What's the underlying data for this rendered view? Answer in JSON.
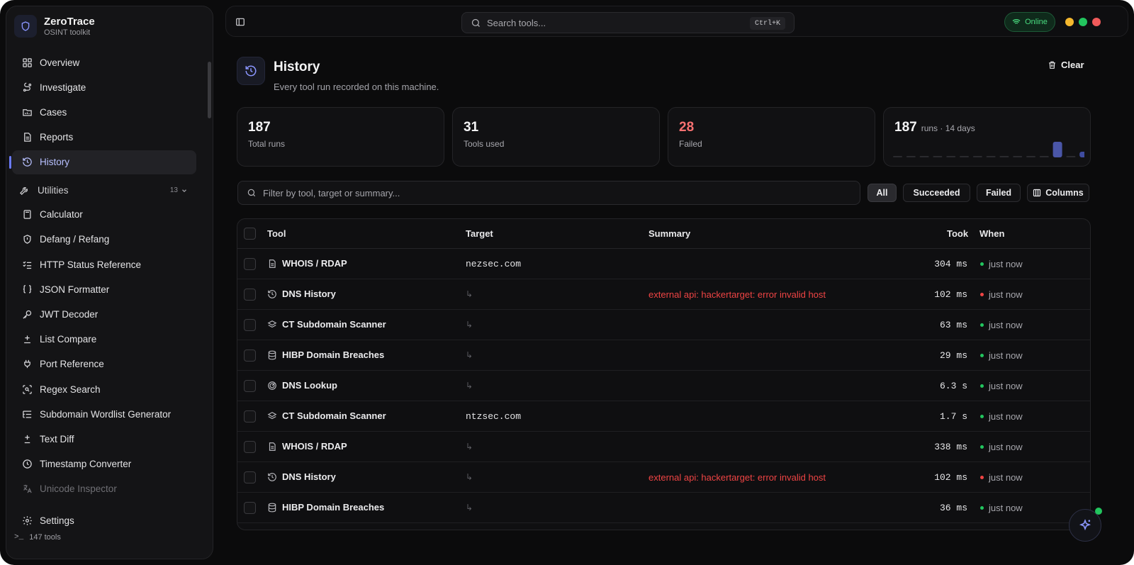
{
  "app": {
    "name": "ZeroTrace",
    "subtitle": "OSINT toolkit"
  },
  "sidebar": {
    "main_items": [
      {
        "label": "Overview",
        "icon": "grid-icon"
      },
      {
        "label": "Investigate",
        "icon": "route-icon"
      },
      {
        "label": "Cases",
        "icon": "folder-icon"
      },
      {
        "label": "Reports",
        "icon": "document-icon"
      },
      {
        "label": "History",
        "icon": "history-icon",
        "active": true
      }
    ],
    "utilities": {
      "label": "Utilities",
      "count": "13"
    },
    "utility_items": [
      {
        "label": "Calculator",
        "icon": "calculator-icon"
      },
      {
        "label": "Defang / Refang",
        "icon": "shield-icon"
      },
      {
        "label": "HTTP Status Reference",
        "icon": "list-check-icon"
      },
      {
        "label": "JSON Formatter",
        "icon": "braces-icon"
      },
      {
        "label": "JWT Decoder",
        "icon": "key-icon"
      },
      {
        "label": "List Compare",
        "icon": "compare-icon"
      },
      {
        "label": "Port Reference",
        "icon": "plug-icon"
      },
      {
        "label": "Regex Search",
        "icon": "regex-icon"
      },
      {
        "label": "Subdomain Wordlist Generator",
        "icon": "list-tree-icon"
      },
      {
        "label": "Text Diff",
        "icon": "diff-icon"
      },
      {
        "label": "Timestamp Converter",
        "icon": "clock-icon"
      },
      {
        "label": "Unicode Inspector",
        "icon": "translate-icon"
      }
    ],
    "settings_label": "Settings",
    "tools_count": "147 tools"
  },
  "topbar": {
    "search_placeholder": "Search tools...",
    "shortcut": "Ctrl+K",
    "status": "Online"
  },
  "page": {
    "title": "History",
    "subtitle": "Every tool run recorded on this machine.",
    "clear_label": "Clear"
  },
  "stats": [
    {
      "value": "187",
      "label": "Total runs"
    },
    {
      "value": "31",
      "label": "Tools used"
    },
    {
      "value": "28",
      "label": "Failed"
    },
    {
      "value": "187",
      "label": "runs · 14 days"
    }
  ],
  "sparkline": [
    0,
    0,
    0,
    0,
    0,
    0,
    0,
    0,
    0,
    0,
    0,
    0,
    22,
    0,
    8
  ],
  "filter": {
    "placeholder": "Filter by tool, target or summary...",
    "chips": [
      "All",
      "Succeeded",
      "Failed"
    ],
    "columns_label": "Columns"
  },
  "table": {
    "headers": [
      "Tool",
      "Target",
      "Summary",
      "Took",
      "When"
    ],
    "rows": [
      {
        "tool": "WHOIS / RDAP",
        "icon": "file-text-icon",
        "target": "nezsec.com",
        "summary": "",
        "took": "304 ms",
        "when": "just now",
        "ok": true
      },
      {
        "tool": "DNS History",
        "icon": "history-icon",
        "target": "↳",
        "summary": "external api: hackertarget: error invalid host",
        "took": "102 ms",
        "when": "just now",
        "ok": false
      },
      {
        "tool": "CT Subdomain Scanner",
        "icon": "layers-icon",
        "target": "↳",
        "summary": "",
        "took": "63 ms",
        "when": "just now",
        "ok": true
      },
      {
        "tool": "HIBP Domain Breaches",
        "icon": "database-icon",
        "target": "↳",
        "summary": "",
        "took": "29 ms",
        "when": "just now",
        "ok": true
      },
      {
        "tool": "DNS Lookup",
        "icon": "radar-icon",
        "target": "↳",
        "summary": "",
        "took": "6.3 s",
        "when": "just now",
        "ok": true
      },
      {
        "tool": "CT Subdomain Scanner",
        "icon": "layers-icon",
        "target": "ntzsec.com",
        "summary": "",
        "took": "1.7 s",
        "when": "just now",
        "ok": true
      },
      {
        "tool": "WHOIS / RDAP",
        "icon": "file-text-icon",
        "target": "↳",
        "summary": "",
        "took": "338 ms",
        "when": "just now",
        "ok": true
      },
      {
        "tool": "DNS History",
        "icon": "history-icon",
        "target": "↳",
        "summary": "external api: hackertarget: error invalid host",
        "took": "102 ms",
        "when": "just now",
        "ok": false
      },
      {
        "tool": "HIBP Domain Breaches",
        "icon": "database-icon",
        "target": "↳",
        "summary": "",
        "took": "36 ms",
        "when": "just now",
        "ok": true
      }
    ]
  },
  "colors": {
    "accent": "#6b7bff",
    "success": "#22c55e",
    "danger": "#ef4444"
  }
}
